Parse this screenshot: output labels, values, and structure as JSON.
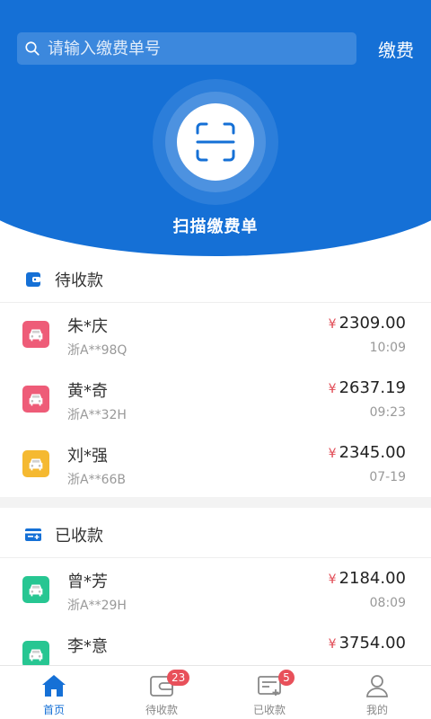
{
  "search": {
    "placeholder": "请输入缴费单号"
  },
  "header": {
    "pay_label": "缴费",
    "scan_label": "扫描缴费单"
  },
  "pending": {
    "title": "待收款",
    "items": [
      {
        "name": "朱*庆",
        "plate": "浙A**98Q",
        "amount": "2309.00",
        "time": "10:09",
        "icon_color": "#ee5c78"
      },
      {
        "name": "黄*奇",
        "plate": "浙A**32H",
        "amount": "2637.19",
        "time": "09:23",
        "icon_color": "#ee5c78"
      },
      {
        "name": "刘*强",
        "plate": "浙A**66B",
        "amount": "2345.00",
        "time": "07-19",
        "icon_color": "#f5b931"
      }
    ]
  },
  "received": {
    "title": "已收款",
    "items": [
      {
        "name": "曾*芳",
        "plate": "浙A**29H",
        "amount": "2184.00",
        "time": "08:09",
        "icon_color": "#27c692"
      },
      {
        "name": "李*意",
        "plate": "",
        "amount": "3754.00",
        "time": "",
        "icon_color": "#27c692"
      }
    ]
  },
  "currency_symbol": "¥",
  "tabs": [
    {
      "label": "首页",
      "icon": "home-icon",
      "badge": ""
    },
    {
      "label": "待收款",
      "icon": "wallet-icon",
      "badge": "23"
    },
    {
      "label": "已收款",
      "icon": "receipt-icon",
      "badge": "5"
    },
    {
      "label": "我的",
      "icon": "user-icon",
      "badge": ""
    }
  ],
  "colors": {
    "primary": "#1570d6",
    "accent_red": "#e14b55",
    "badge": "#e8505a"
  }
}
